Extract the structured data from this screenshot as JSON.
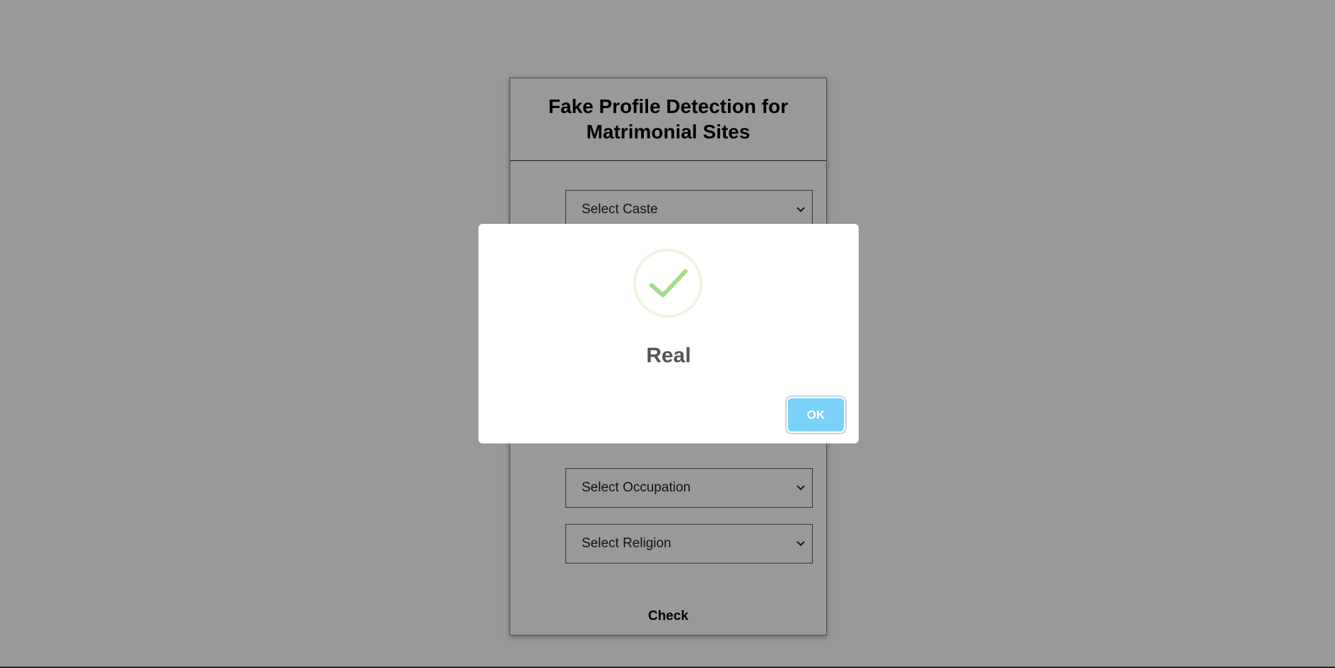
{
  "form": {
    "title": "Fake Profile Detection for Matrimonial Sites",
    "selects": {
      "caste": "Select Caste",
      "occupation": "Select Occupation",
      "religion": "Select Religion"
    },
    "check_label": "Check"
  },
  "modal": {
    "icon": "success-check-icon",
    "title": "Real",
    "ok_label": "OK"
  },
  "colors": {
    "overlay": "#999999",
    "ok_button": "#7cd1f9",
    "success_check": "#a5dc86"
  }
}
